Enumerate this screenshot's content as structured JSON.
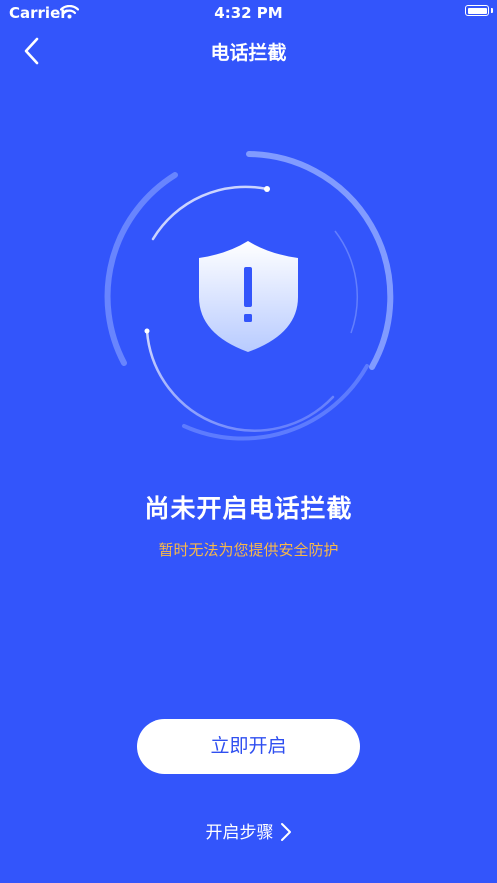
{
  "status_bar": {
    "carrier": "Carrier",
    "time": "4:32 PM",
    "battery_level": 1.0
  },
  "nav": {
    "title": "电话拦截",
    "back_icon": "chevron-left-icon"
  },
  "hero": {
    "icon": "shield-exclamation-icon",
    "headline": "尚未开启电话拦截",
    "subline": "暂时无法为您提供安全防护"
  },
  "actions": {
    "enable_label": "立即开启",
    "steps_label": "开启步骤"
  },
  "colors": {
    "background": "#3355fb",
    "accent_button_text": "#2f4ff0",
    "warning_text": "#f7b84a"
  }
}
